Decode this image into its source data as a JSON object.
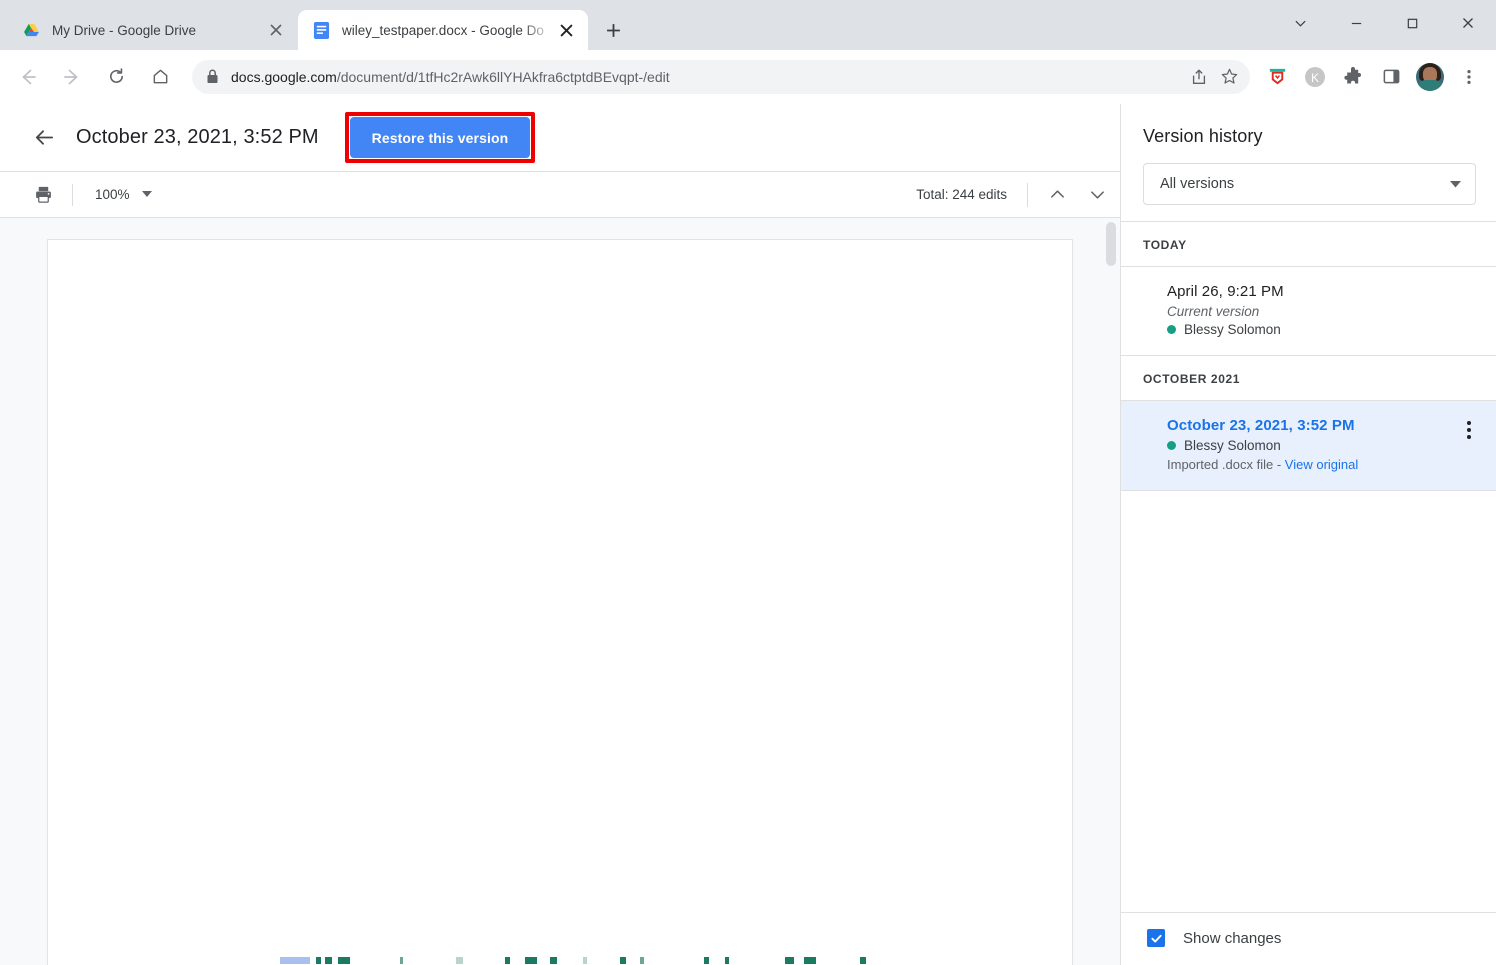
{
  "window": {
    "controls": [
      "chevron-down",
      "minimize",
      "maximize",
      "close"
    ]
  },
  "tabs": [
    {
      "title": "My Drive - Google Drive",
      "favicon": "google-drive-icon",
      "active": false
    },
    {
      "title": "wiley_testpaper.docx - Google Do",
      "favicon": "google-docs-icon",
      "active": true
    }
  ],
  "new_tab_label": "+",
  "omnibox": {
    "secure": true,
    "url_domain": "docs.google.com",
    "url_path": "/document/d/1tfHc2rAwk6llYHAkfra6ctptdBEvqpt-/edit",
    "placeholder": "Search Google or type a URL"
  },
  "browser_icons": {
    "share": "share-icon",
    "bookmark": "star-icon",
    "extension_1": "honey-extension-icon",
    "extension_2": "kaspersky-extension-icon",
    "extensions": "puzzle-piece-icon",
    "side_panel": "side-panel-icon",
    "profile": "profile-avatar",
    "menu": "three-dot-menu-icon"
  },
  "version_header": {
    "back_label": "back-arrow",
    "title": "October 23, 2021, 3:52 PM",
    "restore_label": "Restore this version",
    "highlight_color": "#ef0000",
    "button_color": "#4285f4"
  },
  "doc_toolbar": {
    "print_label": "print-icon",
    "zoom_value": "100%",
    "edits_total": "Total: 244 edits",
    "prev_label": "previous-edit",
    "next_label": "next-edit"
  },
  "sidebar": {
    "title": "Version history",
    "filter_value": "All versions",
    "groups": [
      {
        "label": "TODAY",
        "items": [
          {
            "time": "April 26, 9:21 PM",
            "subtitle": "Current version",
            "author": "Blessy Solomon",
            "author_color": "#15a086",
            "meta": "",
            "meta_link": "",
            "selected": false,
            "has_kebab": false
          }
        ]
      },
      {
        "label": "OCTOBER 2021",
        "items": [
          {
            "time": "October 23, 2021, 3:52 PM",
            "subtitle": "",
            "author": "Blessy Solomon",
            "author_color": "#15a086",
            "meta": "Imported .docx file - ",
            "meta_link": "View original",
            "selected": true,
            "has_kebab": true
          }
        ]
      }
    ],
    "footer": {
      "checkbox_checked": true,
      "checkbox_label": "Show changes",
      "checkbox_color": "#1a73e8"
    }
  }
}
